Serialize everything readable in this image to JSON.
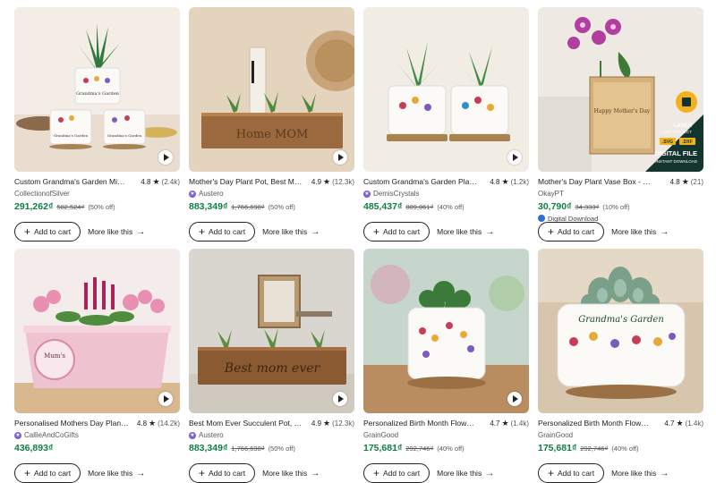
{
  "listings": [
    {
      "title": "Custom Grandma's Garden Mini ...",
      "rating": "4.8",
      "reviews": "(2.4k)",
      "shop": "CollectionofSilver",
      "star_seller": false,
      "price": "291,262₫",
      "original": "582,524₫",
      "discount": "(50% off)",
      "video": true,
      "image": {
        "bg": "#f3ede6",
        "accent": "#2f7a3c"
      },
      "cart": "Add to cart",
      "more": "More like this"
    },
    {
      "title": "Mother's Day Plant Pot, Best Mo...",
      "rating": "4.9",
      "reviews": "(12.3k)",
      "shop": "Austero",
      "star_seller": true,
      "price": "883,349₫",
      "original": "1,766,698₫",
      "discount": "(50% off)",
      "video": true,
      "image": {
        "bg": "#e4d3bd",
        "accent": "#9a6a3e"
      },
      "cart": "Add to cart",
      "more": "More like this"
    },
    {
      "title": "Custom Grandma's Garden Plant...",
      "rating": "4.8",
      "reviews": "(1.2k)",
      "shop": "DemisCrystals",
      "star_seller": true,
      "price": "485,437₫",
      "original": "809,061₫",
      "discount": "(40% off)",
      "video": true,
      "image": {
        "bg": "#f1ece4",
        "accent": "#3f8a44"
      },
      "cart": "Add to cart",
      "more": "More like this"
    },
    {
      "title": "Mother's Day Plant Vase Box - La...",
      "rating": "4.8",
      "reviews": "(21)",
      "shop": "OkayPT",
      "star_seller": false,
      "price": "30,790₫",
      "original": "34,333₫",
      "discount": "(10% off)",
      "digital": "Digital Download",
      "video": false,
      "badge": {
        "line1": "LASER",
        "line2": "CUT PROJECT",
        "fmt1": ".SVG",
        "fmt2": ".DXF",
        "line3": "DIGITAL FILE",
        "line4": "INSTANT DOWNLOAD"
      },
      "image": {
        "bg": "#efe9e4",
        "accent": "#b03fa0"
      },
      "cart": "Add to cart",
      "more": "More like this"
    },
    {
      "title": "Personalised Mothers Day Plant...",
      "rating": "4.8",
      "reviews": "(14.2k)",
      "shop": "CallieAndCoGifts",
      "star_seller": true,
      "price": "436,893₫",
      "original": "",
      "discount": "",
      "video": true,
      "image": {
        "bg": "#f4ecea",
        "accent": "#e98fb2"
      },
      "cart": "Add to cart",
      "more": "More like this"
    },
    {
      "title": "Best Mom Ever Succulent Pot, C...",
      "rating": "4.9",
      "reviews": "(12.3k)",
      "shop": "Austero",
      "star_seller": true,
      "price": "883,349₫",
      "original": "1,766,698₫",
      "discount": "(50% off)",
      "video": true,
      "image": {
        "bg": "#d9d6d0",
        "accent": "#8a5a33"
      },
      "cart": "Add to cart",
      "more": "More like this"
    },
    {
      "title": "Personalized Birth Month Flower...",
      "rating": "4.7",
      "reviews": "(1.4k)",
      "shop": "GrainGood",
      "star_seller": false,
      "price": "175,681₫",
      "original": "292,746₫",
      "discount": "(40% off)",
      "video": true,
      "image": {
        "bg": "#c7d6cc",
        "accent": "#3b7a3a"
      },
      "cart": "Add to cart",
      "more": "More like this"
    },
    {
      "title": "Personalized Birth Month Flower...",
      "rating": "4.7",
      "reviews": "(1.4k)",
      "shop": "GrainGood",
      "star_seller": false,
      "price": "175,681₫",
      "original": "292,746₫",
      "discount": "(40% off)",
      "video": false,
      "image": {
        "bg": "#d8c5ad",
        "accent": "#7aa08a"
      },
      "cart": "Add to cart",
      "more": "More like this"
    }
  ],
  "image_text": {
    "grandma_garden": "Grandma's Garden",
    "best_mom": "Best mom ever",
    "home_mom": "Home MOM",
    "happy_mothers_day": "Happy Mother's Day",
    "mum_label": "Mum's"
  },
  "colors": {
    "price": "#0e7e45",
    "star_seller": "#7c5fd6",
    "text": "#222222"
  }
}
